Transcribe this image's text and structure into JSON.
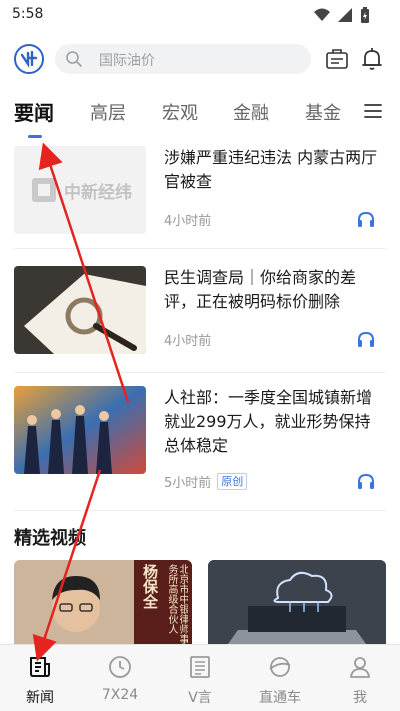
{
  "status_bar": {
    "time": "5:58"
  },
  "search": {
    "placeholder": "国际油价"
  },
  "tabs": [
    "要闻",
    "高层",
    "宏观",
    "金融",
    "基金"
  ],
  "news": [
    {
      "title": "涉嫌严重违纪违法 内蒙古两厅官被查",
      "time": "4小时前",
      "badge": "",
      "thumb_brand": "中新经纬"
    },
    {
      "title": "民生调查局｜你给商家的差评，正在被明码标价删除",
      "time": "4小时前",
      "badge": ""
    },
    {
      "title": "人社部：一季度全国城镇新增就业299万人，就业形势保持总体稳定",
      "time": "5小时前",
      "badge": "原创"
    }
  ],
  "section": {
    "videos_title": "精选视频"
  },
  "video_cards": [
    {
      "name": "杨保全",
      "caption": "北京市中银律师事务所高级合伙人"
    },
    {
      "name": "",
      "caption": ""
    }
  ],
  "bottom_nav": [
    {
      "label": "新闻",
      "icon": "news-icon",
      "active": true
    },
    {
      "label": "7X24",
      "icon": "clock-icon",
      "active": false
    },
    {
      "label": "V言",
      "icon": "document-icon",
      "active": false
    },
    {
      "label": "直通车",
      "icon": "planet-icon",
      "active": false
    },
    {
      "label": "我",
      "icon": "person-icon",
      "active": false
    }
  ],
  "colors": {
    "accent": "#3a73e0",
    "annotation": "#e52420"
  }
}
